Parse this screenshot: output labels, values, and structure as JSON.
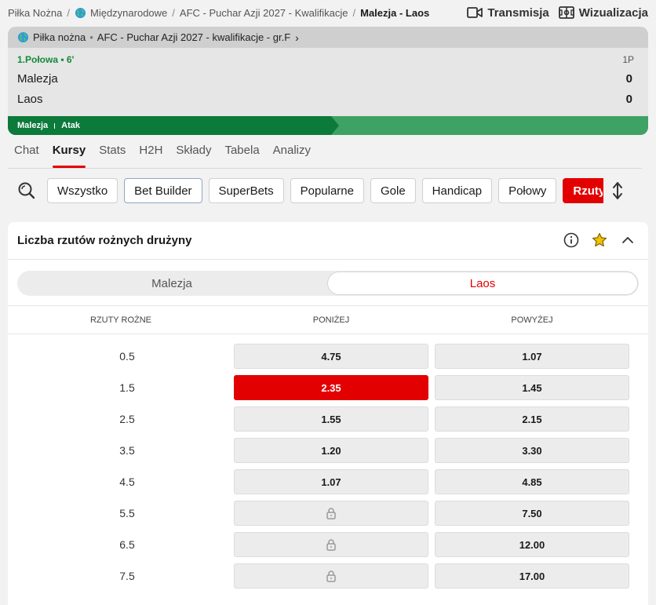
{
  "breadcrumb": [
    {
      "label": "Piłka Nożna",
      "globe": false
    },
    {
      "label": "Międzynarodowe",
      "globe": true
    },
    {
      "label": "AFC - Puchar Azji 2027 - Kwalifikacje",
      "globe": false
    }
  ],
  "breadcrumb_current": "Malezja - Laos",
  "top_actions": {
    "stream": "Transmisja",
    "viz": "Wizualizacja"
  },
  "scoreboard": {
    "sport": "Piłka nożna",
    "competition": "AFC - Puchar Azji 2027 - kwalifikacje - gr.F",
    "status": "1.Połowa • 6'",
    "period": "1P",
    "home": {
      "name": "Malezja",
      "score": "0"
    },
    "away": {
      "name": "Laos",
      "score": "0"
    },
    "momentum_team": "Malezja",
    "momentum_state": "Atak",
    "momentum_share": 0.51
  },
  "tabs": [
    {
      "label": "Chat",
      "active": false
    },
    {
      "label": "Kursy",
      "active": true
    },
    {
      "label": "Stats",
      "active": false
    },
    {
      "label": "H2H",
      "active": false
    },
    {
      "label": "Składy",
      "active": false
    },
    {
      "label": "Tabela",
      "active": false
    },
    {
      "label": "Analizy",
      "active": false
    }
  ],
  "filters": [
    {
      "label": "Wszystko",
      "style": "normal"
    },
    {
      "label": "Bet Builder",
      "style": "outlined"
    },
    {
      "label": "SuperBets",
      "style": "normal"
    },
    {
      "label": "Popularne",
      "style": "normal"
    },
    {
      "label": "Gole",
      "style": "normal"
    },
    {
      "label": "Handicap",
      "style": "normal"
    },
    {
      "label": "Połowy",
      "style": "normal"
    },
    {
      "label": "Rzuty",
      "style": "active"
    }
  ],
  "market": {
    "title": "Liczba rzutów rożnych drużyny",
    "teams": [
      {
        "label": "Malezja",
        "active": false
      },
      {
        "label": "Laos",
        "active": true
      }
    ],
    "columns": {
      "line": "RZUTY ROŻNE",
      "under": "PONIŻEJ",
      "over": "POWYŻEJ"
    },
    "rows": [
      {
        "line": "0.5",
        "under": "4.75",
        "over": "1.07",
        "under_locked": false,
        "under_selected": false
      },
      {
        "line": "1.5",
        "under": "2.35",
        "over": "1.45",
        "under_locked": false,
        "under_selected": true
      },
      {
        "line": "2.5",
        "under": "1.55",
        "over": "2.15",
        "under_locked": false,
        "under_selected": false
      },
      {
        "line": "3.5",
        "under": "1.20",
        "over": "3.30",
        "under_locked": false,
        "under_selected": false
      },
      {
        "line": "4.5",
        "under": "1.07",
        "over": "4.85",
        "under_locked": false,
        "under_selected": false
      },
      {
        "line": "5.5",
        "under": "",
        "over": "7.50",
        "under_locked": true,
        "under_selected": false
      },
      {
        "line": "6.5",
        "under": "",
        "over": "12.00",
        "under_locked": true,
        "under_selected": false
      },
      {
        "line": "7.5",
        "under": "",
        "over": "17.00",
        "under_locked": true,
        "under_selected": false
      }
    ]
  },
  "colors": {
    "accent": "#e30000",
    "live_green": "#138a3c",
    "momentum_dark": "#0b7a3a",
    "momentum_light": "#3ea265"
  }
}
